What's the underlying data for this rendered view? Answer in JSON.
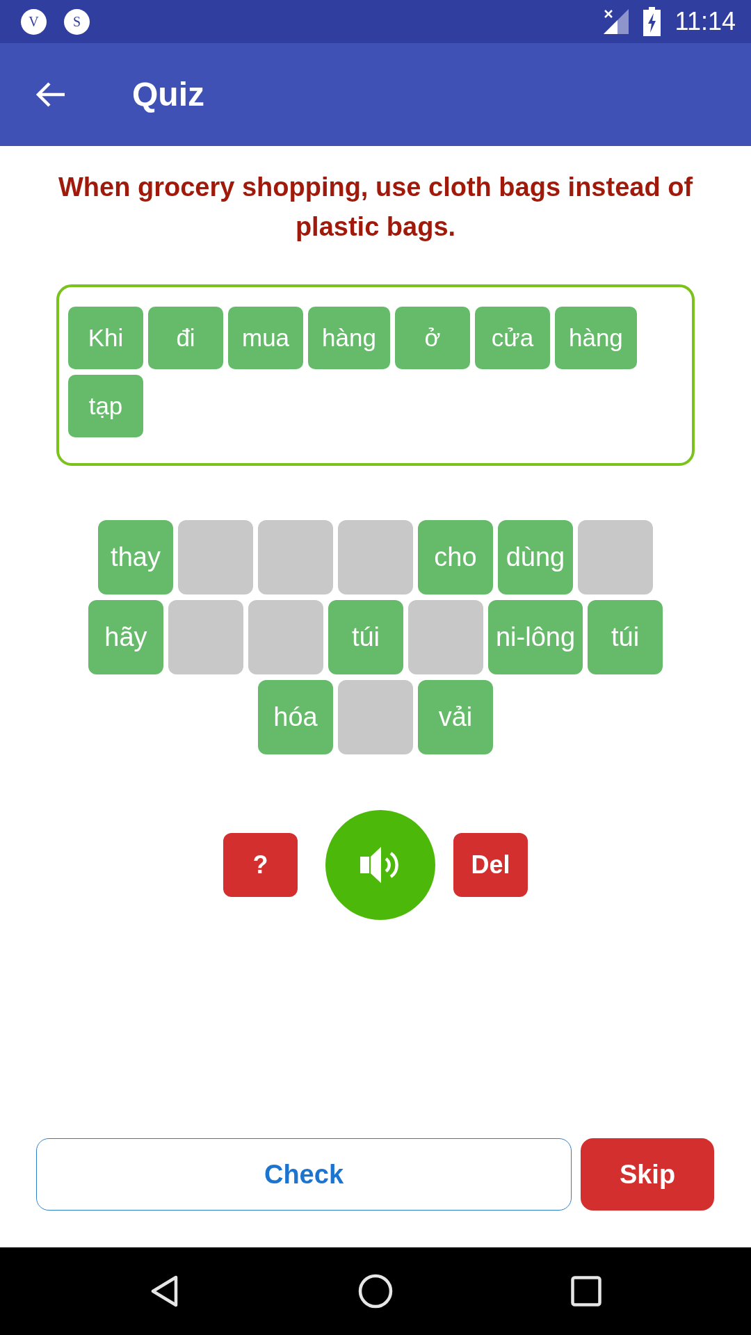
{
  "status_bar": {
    "notifications": [
      {
        "letter": "V"
      },
      {
        "letter": "S"
      }
    ],
    "time": "11:14"
  },
  "app_bar": {
    "title": "Quiz"
  },
  "prompt": "When grocery shopping, use cloth bags instead of plastic bags.",
  "answer_words": [
    "Khi",
    "đi",
    "mua",
    "hàng",
    "ở",
    "cửa",
    "hàng",
    "tạp"
  ],
  "word_bank": [
    {
      "text": "thay",
      "used": false
    },
    {
      "used": true
    },
    {
      "used": true
    },
    {
      "used": true
    },
    {
      "text": "cho",
      "used": false
    },
    {
      "text": "dùng",
      "used": false
    },
    {
      "used": true
    },
    {
      "text": "hãy",
      "used": false
    },
    {
      "used": true
    },
    {
      "used": true
    },
    {
      "text": "túi",
      "used": false
    },
    {
      "used": true
    },
    {
      "text": "ni-lông",
      "used": false
    },
    {
      "text": "túi",
      "used": false
    },
    {
      "text": "hóa",
      "used": false
    },
    {
      "used": true
    },
    {
      "text": "vải",
      "used": false
    }
  ],
  "actions": {
    "hint": "?",
    "delete": "Del"
  },
  "footer": {
    "check": "Check",
    "skip": "Skip"
  }
}
